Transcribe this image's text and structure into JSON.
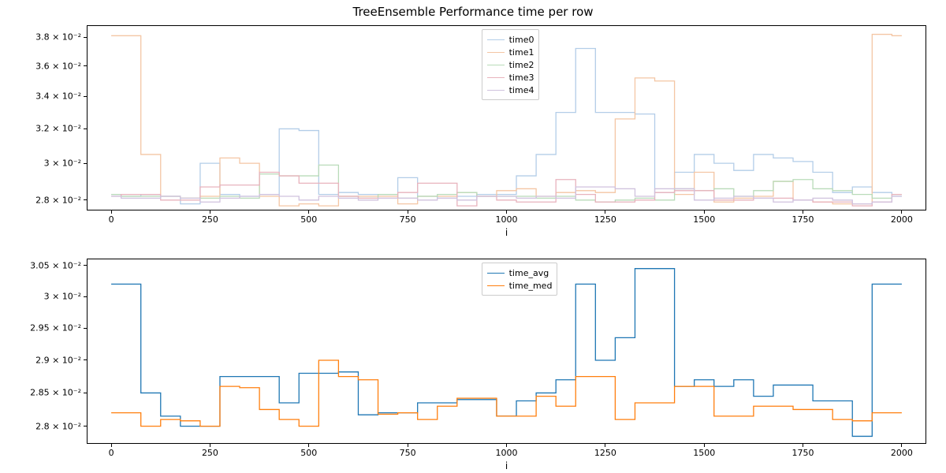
{
  "title": "TreeEnsemble Performance time per row",
  "xlabel": "i",
  "colors": {
    "time0": "#b3cde8",
    "time1": "#f4c6a4",
    "time2": "#b9dbb9",
    "time3": "#e8b3bd",
    "time4": "#d0c2de",
    "time_avg": "#1f77b4",
    "time_med": "#ff7f0e"
  },
  "top": {
    "x_ticks": [
      0,
      250,
      500,
      750,
      1000,
      1250,
      1500,
      1750,
      2000
    ],
    "y_ticks_raw": [
      0.028,
      0.03,
      0.032,
      0.034,
      0.036,
      0.038
    ],
    "y_tick_labels": [
      "2.8 × 10⁻²",
      "3 × 10⁻²",
      "3.2 × 10⁻²",
      "3.4 × 10⁻²",
      "3.6 × 10⁻²",
      "3.8 × 10⁻²"
    ],
    "ylim": [
      0.0275,
      0.0388
    ],
    "xlim": [
      -60,
      2060
    ],
    "legend": [
      "time0",
      "time1",
      "time2",
      "time3",
      "time4"
    ]
  },
  "bottom": {
    "x_ticks": [
      0,
      250,
      500,
      750,
      1000,
      1250,
      1500,
      1750,
      2000
    ],
    "y_ticks_raw": [
      0.028,
      0.0285,
      0.029,
      0.0295,
      0.03,
      0.0305
    ],
    "y_tick_labels": [
      "2.8 × 10⁻²",
      "2.85 × 10⁻²",
      "2.9 × 10⁻²",
      "2.95 × 10⁻²",
      "3 × 10⁻²",
      "3.05 × 10⁻²"
    ],
    "ylim": [
      0.02775,
      0.0306
    ],
    "xlim": [
      -60,
      2060
    ],
    "legend": [
      "time_avg",
      "time_med"
    ]
  },
  "chart_data": [
    {
      "type": "line-step",
      "title": "TreeEnsemble Performance time per row",
      "xlabel": "i",
      "ylabel": "",
      "xlim": [
        -60,
        2060
      ],
      "ylim": [
        0.0275,
        0.0388
      ],
      "x": [
        0,
        50,
        100,
        150,
        200,
        250,
        300,
        350,
        400,
        450,
        500,
        550,
        600,
        650,
        700,
        750,
        800,
        850,
        900,
        950,
        1000,
        1050,
        1100,
        1150,
        1200,
        1250,
        1300,
        1350,
        1400,
        1450,
        1500,
        1550,
        1600,
        1650,
        1700,
        1750,
        1800,
        1850,
        1900,
        1950,
        2000
      ],
      "series": [
        {
          "name": "time0",
          "values": [
            0.0283,
            0.0282,
            0.0283,
            0.0282,
            0.0278,
            0.03,
            0.0283,
            0.0282,
            0.0283,
            0.032,
            0.0319,
            0.0283,
            0.0284,
            0.0283,
            0.0283,
            0.0292,
            0.0282,
            0.0281,
            0.0282,
            0.0283,
            0.0283,
            0.0293,
            0.0305,
            0.033,
            0.0372,
            0.033,
            0.033,
            0.0329,
            0.0284,
            0.0295,
            0.0305,
            0.03,
            0.0296,
            0.0305,
            0.0303,
            0.0301,
            0.0295,
            0.0284,
            0.0287,
            0.0284,
            0.0282
          ]
        },
        {
          "name": "time1",
          "values": [
            0.0381,
            0.0381,
            0.0305,
            0.0282,
            0.0281,
            0.0282,
            0.0303,
            0.03,
            0.0282,
            0.0277,
            0.0278,
            0.0277,
            0.0282,
            0.0282,
            0.0282,
            0.0278,
            0.0282,
            0.0282,
            0.0284,
            0.0282,
            0.0285,
            0.0286,
            0.0282,
            0.0284,
            0.0285,
            0.0284,
            0.0326,
            0.0352,
            0.035,
            0.0283,
            0.0295,
            0.0279,
            0.0281,
            0.0282,
            0.029,
            0.028,
            0.0279,
            0.0278,
            0.0278,
            0.0382,
            0.0381
          ]
        },
        {
          "name": "time2",
          "values": [
            0.0283,
            0.0282,
            0.0282,
            0.0282,
            0.0281,
            0.0281,
            0.0282,
            0.0281,
            0.0294,
            0.0293,
            0.0293,
            0.0299,
            0.0282,
            0.0281,
            0.0283,
            0.0281,
            0.0282,
            0.0283,
            0.0284,
            0.0282,
            0.0282,
            0.0282,
            0.0281,
            0.0282,
            0.028,
            0.0279,
            0.028,
            0.0281,
            0.028,
            0.0286,
            0.0285,
            0.0286,
            0.0282,
            0.0285,
            0.029,
            0.0291,
            0.0286,
            0.0285,
            0.0283,
            0.0281,
            0.0283
          ]
        },
        {
          "name": "time3",
          "values": [
            0.0282,
            0.0283,
            0.0283,
            0.028,
            0.028,
            0.0287,
            0.0288,
            0.0288,
            0.0295,
            0.0293,
            0.0289,
            0.0289,
            0.0282,
            0.0281,
            0.0281,
            0.0284,
            0.0289,
            0.0289,
            0.0277,
            0.0282,
            0.028,
            0.0279,
            0.0279,
            0.0291,
            0.0283,
            0.0279,
            0.0279,
            0.028,
            0.0284,
            0.0285,
            0.0285,
            0.028,
            0.028,
            0.0281,
            0.0281,
            0.028,
            0.0279,
            0.0279,
            0.0277,
            0.0279,
            0.0283
          ]
        },
        {
          "name": "time4",
          "values": [
            0.0282,
            0.0281,
            0.0281,
            0.0282,
            0.0281,
            0.0279,
            0.0281,
            0.0282,
            0.0283,
            0.0282,
            0.028,
            0.0282,
            0.0281,
            0.028,
            0.0281,
            0.0281,
            0.028,
            0.0281,
            0.028,
            0.0282,
            0.0282,
            0.0281,
            0.0282,
            0.0281,
            0.0287,
            0.0287,
            0.0286,
            0.0282,
            0.0286,
            0.0286,
            0.028,
            0.0281,
            0.0282,
            0.0281,
            0.0279,
            0.028,
            0.0281,
            0.028,
            0.0278,
            0.0279,
            0.0282
          ]
        }
      ]
    },
    {
      "type": "line-step",
      "xlabel": "i",
      "ylabel": "",
      "xlim": [
        -60,
        2060
      ],
      "ylim": [
        0.02775,
        0.0306
      ],
      "x": [
        0,
        50,
        100,
        150,
        200,
        250,
        300,
        350,
        400,
        450,
        500,
        550,
        600,
        650,
        700,
        750,
        800,
        850,
        900,
        950,
        1000,
        1050,
        1100,
        1150,
        1200,
        1250,
        1300,
        1350,
        1400,
        1450,
        1500,
        1550,
        1600,
        1650,
        1700,
        1750,
        1800,
        1850,
        1900,
        1950,
        2000
      ],
      "series": [
        {
          "name": "time_avg",
          "values": [
            0.0302,
            0.0302,
            0.0285,
            0.02815,
            0.028,
            0.028,
            0.02875,
            0.02875,
            0.02875,
            0.02835,
            0.0288,
            0.0288,
            0.02882,
            0.02817,
            0.0282,
            0.0282,
            0.02835,
            0.02835,
            0.0284,
            0.0284,
            0.02815,
            0.02838,
            0.0285,
            0.0287,
            0.0302,
            0.029,
            0.02935,
            0.03045,
            0.03045,
            0.0286,
            0.0287,
            0.0286,
            0.0287,
            0.02845,
            0.02862,
            0.02862,
            0.02838,
            0.02838,
            0.02785,
            0.0302,
            0.0302
          ]
        },
        {
          "name": "time_med",
          "values": [
            0.0282,
            0.0282,
            0.028,
            0.0281,
            0.02808,
            0.028,
            0.0286,
            0.02858,
            0.02825,
            0.0281,
            0.028,
            0.029,
            0.02875,
            0.0287,
            0.02818,
            0.0282,
            0.0281,
            0.0283,
            0.02842,
            0.02842,
            0.02815,
            0.02815,
            0.02845,
            0.0283,
            0.02875,
            0.02875,
            0.0281,
            0.02835,
            0.02835,
            0.0286,
            0.0286,
            0.02815,
            0.02815,
            0.0283,
            0.0283,
            0.02825,
            0.02825,
            0.0281,
            0.02808,
            0.0282,
            0.0282
          ]
        }
      ]
    }
  ]
}
